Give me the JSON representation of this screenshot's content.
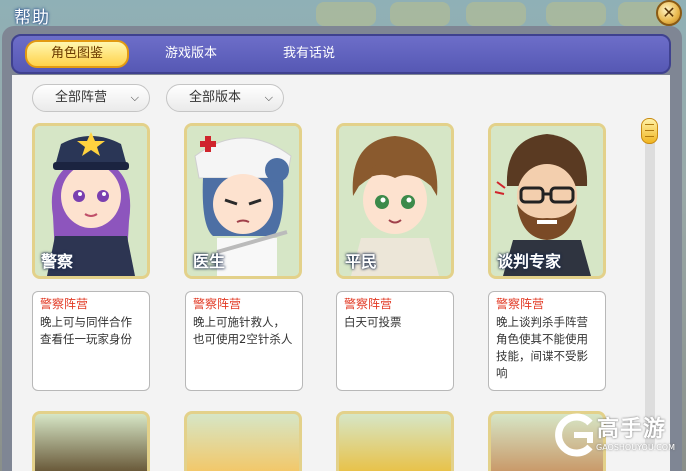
{
  "window": {
    "title": "帮助",
    "close_icon": "close-icon"
  },
  "tabs": [
    {
      "label": "角色图鉴",
      "active": true
    },
    {
      "label": "游戏版本",
      "active": false
    },
    {
      "label": "我有话说",
      "active": false
    }
  ],
  "filters": {
    "camp": "全部阵营",
    "version": "全部版本"
  },
  "roles": [
    {
      "name": "警察",
      "faction": "警察阵营",
      "desc": "晚上可与同伴合作查看任一玩家身份",
      "color": "#7d4fb0"
    },
    {
      "name": "医生",
      "faction": "警察阵营",
      "desc": "晚上可施针救人，也可使用2空针杀人",
      "color": "#4a6fa8"
    },
    {
      "name": "平民",
      "faction": "警察阵营",
      "desc": "白天可投票",
      "color": "#8a5a2e"
    },
    {
      "name": "谈判专家",
      "faction": "警察阵营",
      "desc": "晚上谈判杀手阵营角色使其不能使用技能，间谍不受影响",
      "color": "#5a3a22"
    }
  ],
  "watermark": {
    "title": "高手游",
    "sub": "GAOSHOUYOU.COM"
  }
}
